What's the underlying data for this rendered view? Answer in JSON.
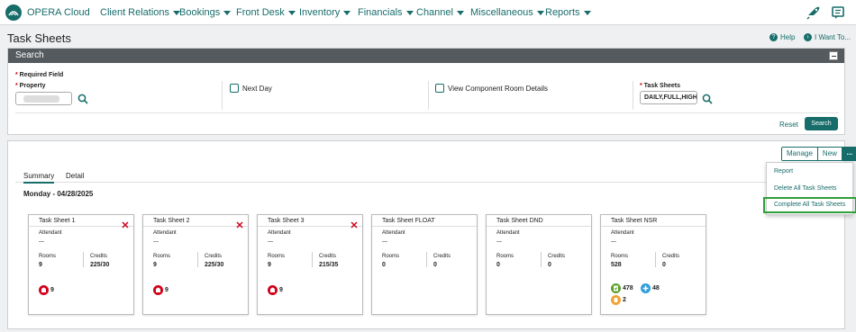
{
  "app": {
    "logo_text": "OPERA Cloud"
  },
  "nav": {
    "items": [
      {
        "label": "Client Relations"
      },
      {
        "label": "Bookings"
      },
      {
        "label": "Front Desk"
      },
      {
        "label": "Inventory"
      },
      {
        "label": "Financials"
      },
      {
        "label": "Channel"
      },
      {
        "label": "Miscellaneous"
      },
      {
        "label": "Reports"
      }
    ]
  },
  "header": {
    "title": "Task Sheets",
    "help": "Help",
    "i_want_to": "I Want To..."
  },
  "search": {
    "heading": "Search",
    "required_note": "Required Field",
    "property_label": "Property",
    "next_day": "Next Day",
    "view_component": "View Component Room Details",
    "task_sheets_label": "Task Sheets",
    "task_sheets_value": "DAILY,FULL,HIGH",
    "reset": "Reset",
    "search_button": "Search"
  },
  "results": {
    "manage": "Manage",
    "new": "New",
    "more": "...",
    "tabs": [
      "Summary",
      "Detail"
    ],
    "date": "Monday - 04/28/2025",
    "labels": {
      "attendant": "Attendant",
      "rooms": "Rooms",
      "credits": "Credits",
      "dash": "—"
    },
    "cards": [
      {
        "title": "Task Sheet 1",
        "rooms": "9",
        "credits": "225/30",
        "red_count": "9"
      },
      {
        "title": "Task Sheet 2",
        "rooms": "9",
        "credits": "225/30",
        "red_count": "9"
      },
      {
        "title": "Task Sheet 3",
        "rooms": "9",
        "credits": "215/35",
        "red_count": "9"
      },
      {
        "title": "Task Sheet FLOAT",
        "rooms": "0",
        "credits": "0"
      },
      {
        "title": "Task Sheet DND",
        "rooms": "0",
        "credits": "0"
      },
      {
        "title": "Task Sheet NSR",
        "rooms": "528",
        "credits": "0",
        "green_count": "478",
        "blue_count": "48",
        "orange_count": "2"
      }
    ]
  },
  "menu": {
    "items": [
      "Report",
      "Delete All Task Sheets",
      "Complete All Task Sheets"
    ]
  },
  "colors": {
    "brand": "#176d6a",
    "dirty": "#d0021b",
    "clean": "#5ca02a",
    "inspected": "#2d9cdb",
    "pickup": "#f2a233",
    "highlight": "#2e9f39"
  }
}
